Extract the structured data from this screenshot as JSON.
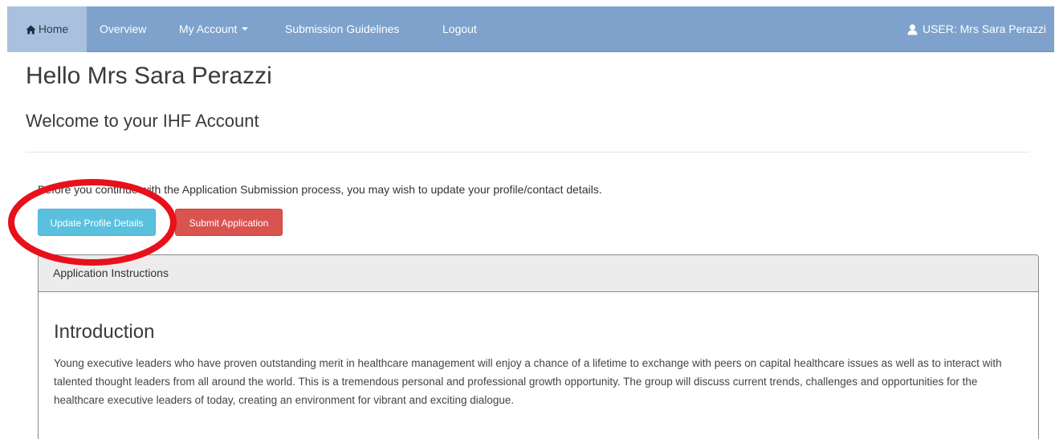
{
  "navbar": {
    "home_label": "Home",
    "overview_label": "Overview",
    "account_label": "My Account",
    "guidelines_label": "Submission Guidelines",
    "logout_label": "Logout",
    "user_label": "USER:  Mrs Sara Perazzi"
  },
  "main": {
    "greeting": "Hello Mrs Sara Perazzi",
    "welcome": "Welcome to your IHF Account",
    "intro_note": "Before you continue with the Application Submission process, you may wish to update your profile/contact details.",
    "update_button": "Update Profile Details",
    "submit_button": "Submit Application"
  },
  "panel": {
    "heading": "Application Instructions",
    "intro_title": "Introduction",
    "intro_text": "Young executive leaders who have proven outstanding merit in healthcare management will enjoy a chance of a lifetime to exchange with peers on capital healthcare issues as well as to interact with talented thought leaders from all around the world. This is a tremendous personal and professional growth opportunity. The group will discuss current trends, challenges and opportunities for the healthcare executive leaders of today, creating an environment for vibrant and exciting dialogue."
  },
  "colors": {
    "navbar": "#7ea2cc",
    "navbar_active": "#a9c1de",
    "button_info": "#5bc0de",
    "button_danger": "#d9534f",
    "annotation": "#e8101a"
  }
}
